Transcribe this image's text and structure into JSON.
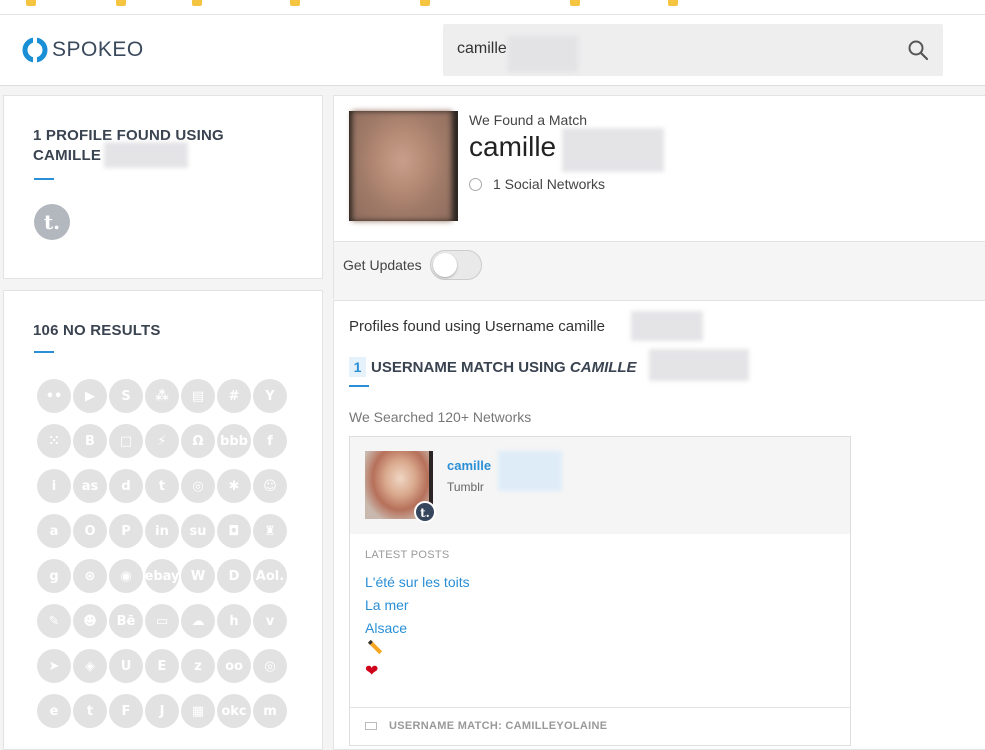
{
  "header": {
    "logo_text": "SPOKEO",
    "search_value": "camille"
  },
  "sidebar": {
    "profiles_title": "1 PROFILE FOUND USING CAMILLE",
    "profile_network_glyph": "t.",
    "no_results_title": "106 NO RESULTS",
    "networks": [
      {
        "name": "flickr-icon",
        "glyph": "••"
      },
      {
        "name": "youtube-icon",
        "glyph": "▶"
      },
      {
        "name": "skype-icon",
        "glyph": "S"
      },
      {
        "name": "myspace-icon",
        "glyph": "⁂"
      },
      {
        "name": "blog-icon",
        "glyph": "▤"
      },
      {
        "name": "slack-icon",
        "glyph": "#"
      },
      {
        "name": "ycombinator-icon",
        "glyph": "Y"
      },
      {
        "name": "blank-icon",
        "glyph": ""
      },
      {
        "name": "grid-icon",
        "glyph": "⁙"
      },
      {
        "name": "blogger-icon",
        "glyph": "B"
      },
      {
        "name": "square-icon",
        "glyph": "□"
      },
      {
        "name": "zap-icon",
        "glyph": "⚡"
      },
      {
        "name": "headphones-icon",
        "glyph": "Ω"
      },
      {
        "name": "bbb-icon",
        "glyph": "bbb"
      },
      {
        "name": "facebook-icon",
        "glyph": "f"
      },
      {
        "name": "blank-icon",
        "glyph": ""
      },
      {
        "name": "info-icon",
        "glyph": "i"
      },
      {
        "name": "lastfm-icon",
        "glyph": "as"
      },
      {
        "name": "dailymotion-icon",
        "glyph": "d"
      },
      {
        "name": "twitter-icon",
        "glyph": "t"
      },
      {
        "name": "aperture-icon",
        "glyph": "◎"
      },
      {
        "name": "yelp-icon",
        "glyph": "✱"
      },
      {
        "name": "face-icon",
        "glyph": "☺"
      },
      {
        "name": "blank-icon",
        "glyph": ""
      },
      {
        "name": "amazon-icon",
        "glyph": "a"
      },
      {
        "name": "circle-icon",
        "glyph": "O"
      },
      {
        "name": "pinterest-icon",
        "glyph": "P"
      },
      {
        "name": "linkedin-icon",
        "glyph": "in"
      },
      {
        "name": "stumbleupon-icon",
        "glyph": "su"
      },
      {
        "name": "instagram-icon",
        "glyph": "◘"
      },
      {
        "name": "popcorn-icon",
        "glyph": "♜"
      },
      {
        "name": "blank-icon",
        "glyph": ""
      },
      {
        "name": "goodreads-icon",
        "glyph": "g"
      },
      {
        "name": "dribbble-icon",
        "glyph": "⊛"
      },
      {
        "name": "eye-icon",
        "glyph": "◉"
      },
      {
        "name": "ebay-icon",
        "glyph": "ebay"
      },
      {
        "name": "wordpress-icon",
        "glyph": "W"
      },
      {
        "name": "disqus-icon",
        "glyph": "D"
      },
      {
        "name": "aol-icon",
        "glyph": "Aol."
      },
      {
        "name": "blank-icon",
        "glyph": ""
      },
      {
        "name": "shoe-icon",
        "glyph": "✎"
      },
      {
        "name": "smile-icon",
        "glyph": "☻"
      },
      {
        "name": "behance-icon",
        "glyph": "Bē"
      },
      {
        "name": "lego-icon",
        "glyph": "▭"
      },
      {
        "name": "soundcloud-icon",
        "glyph": "☁"
      },
      {
        "name": "houzz-icon",
        "glyph": "h"
      },
      {
        "name": "vimeo-icon",
        "glyph": "v"
      },
      {
        "name": "blank-icon",
        "glyph": ""
      },
      {
        "name": "bird-icon",
        "glyph": "➤"
      },
      {
        "name": "bag-icon",
        "glyph": "◈"
      },
      {
        "name": "ustream-icon",
        "glyph": "U"
      },
      {
        "name": "e-icon",
        "glyph": "E"
      },
      {
        "name": "z-icon",
        "glyph": "z"
      },
      {
        "name": "tripadvisor-icon",
        "glyph": "oo"
      },
      {
        "name": "target-icon",
        "glyph": "◎"
      },
      {
        "name": "blank-icon",
        "glyph": ""
      },
      {
        "name": "etsy-icon",
        "glyph": "e"
      },
      {
        "name": "tumblr-icon",
        "glyph": "t"
      },
      {
        "name": "foursquare-icon",
        "glyph": "F"
      },
      {
        "name": "j-icon",
        "glyph": "J"
      },
      {
        "name": "ravelry-icon",
        "glyph": "▦"
      },
      {
        "name": "okcupid-icon",
        "glyph": "okc"
      },
      {
        "name": "m-icon",
        "glyph": "m"
      }
    ]
  },
  "match": {
    "found_label": "We Found a Match",
    "name": "camille",
    "social_count_text": "1 Social Networks",
    "get_updates_label": "Get Updates"
  },
  "results": {
    "profiles_found_label": "Profiles found using Username camille",
    "match_count": "1",
    "match_title": "USERNAME MATCH USING",
    "match_title_italic": "CAMILLE",
    "searched_label": "We Searched 120+ Networks",
    "item": {
      "name": "camille",
      "network": "Tumblr",
      "badge_glyph": "t.",
      "latest_label": "LATEST POSTS",
      "posts": [
        "L'été sur les toits",
        "La mer",
        "Alsace"
      ],
      "heart_glyph": "❤",
      "footer_label": "USERNAME MATCH: CAMILLEYOLAINE"
    }
  },
  "colors": {
    "accent": "#2a8fd6",
    "heading": "#3a4350",
    "tumblr_badge": "#36465d"
  }
}
